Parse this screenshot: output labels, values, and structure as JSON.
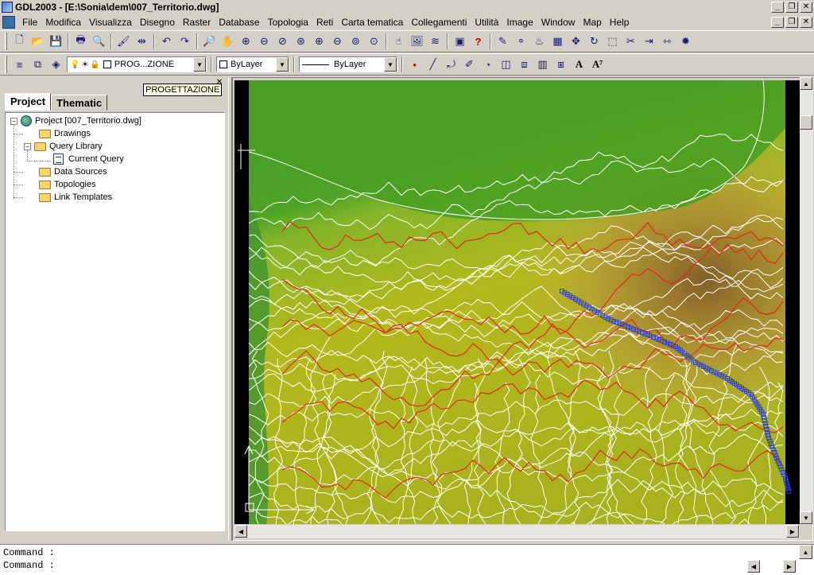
{
  "window": {
    "title": "GDL2003 - [E:\\Sonia\\dem\\007_Territorio.dwg]",
    "controls": {
      "minimize": "_",
      "restore": "❐",
      "close": "✕"
    }
  },
  "menu": [
    "File",
    "Modifica",
    "Visualizza",
    "Disegno",
    "Raster",
    "Database",
    "Topologia",
    "Reti",
    "Carta tematica",
    "Collegamenti",
    "Utilità",
    "Image",
    "Window",
    "Map",
    "Help"
  ],
  "toolbar1": {
    "icons": [
      "new-icon",
      "open-icon",
      "save-icon",
      "print-icon",
      "print-preview-icon",
      "match-properties-icon",
      "measure-icon",
      "undo-icon",
      "redo-icon",
      "zoom-realtime-icon",
      "pan-icon",
      "zoom-window-icon",
      "zoom-dynamic-icon",
      "zoom-scale-icon",
      "zoom-center-icon",
      "zoom-in-icon",
      "zoom-out-icon",
      "zoom-all-icon",
      "zoom-extents-icon",
      "map-query-icon",
      "image-insert-icon",
      "rainbow-icon",
      "layer-display-icon",
      "help-icon",
      "edit-icon",
      "nodes-icon",
      "topology-icon",
      "grid-icon",
      "move-icon",
      "rotate-icon",
      "scale-icon",
      "trim-icon",
      "extend-icon",
      "break-icon",
      "explode-icon"
    ],
    "glyphs": [
      "🗋",
      "📂",
      "💾",
      "🖶",
      "🔍",
      "🖌",
      "⇹",
      "↶",
      "↷",
      "🔎",
      "✋",
      "⊕",
      "⊖",
      "⊘",
      "⊛",
      "⊕",
      "⊖",
      "⊚",
      "⊙",
      "☝",
      "🖼",
      "≋",
      "▣",
      "?",
      "✎",
      "⚬",
      "♨",
      "▦",
      "✥",
      "↻",
      "⬚",
      "✂",
      "⇥",
      "⇿",
      "✹"
    ]
  },
  "toolbar2": {
    "layer_combo": "PROG...ZIONE",
    "color_combo": "ByLayer",
    "linetype_combo": "ByLayer",
    "icons": [
      "layers-icon",
      "layer-states-icon",
      "layer-stack-icon",
      "layer-on-icon",
      "layer-freeze-icon",
      "layer-lock-icon",
      "point-icon",
      "line-icon",
      "polyline-icon",
      "pencil-icon",
      "circle-icon",
      "area-icon",
      "block-icon",
      "hatch-icon",
      "table-icon",
      "text-icon",
      "text-edit-icon"
    ],
    "glyphs": [
      "≡",
      "⧉",
      "◈",
      "💡",
      "☀",
      "🔒",
      "•",
      "╱",
      "⤾",
      "✐",
      "◔",
      "◫",
      "⧈",
      "▥",
      "⧆",
      "A",
      "A⁷"
    ]
  },
  "left_panel": {
    "tooltip": "PROGETTAZIONE",
    "tabs": [
      "Project",
      "Thematic"
    ],
    "tree": {
      "root": "Project [007_Territorio.dwg]",
      "drawings": "Drawings",
      "query_library": "Query Library",
      "current_query": "Current Query",
      "data_sources": "Data Sources",
      "topologies": "Topologies",
      "link_templates": "Link Templates"
    }
  },
  "map": {
    "colors": {
      "low": "#3e9a2a",
      "mid": "#a6b91b",
      "high": "#c9b14a",
      "peak": "#8a5a2a",
      "contour": "#ffffff",
      "contour_major": "#e2261c",
      "track": "#2a3fd6"
    }
  },
  "command": {
    "line1": "Command :",
    "line2": "Command :"
  }
}
